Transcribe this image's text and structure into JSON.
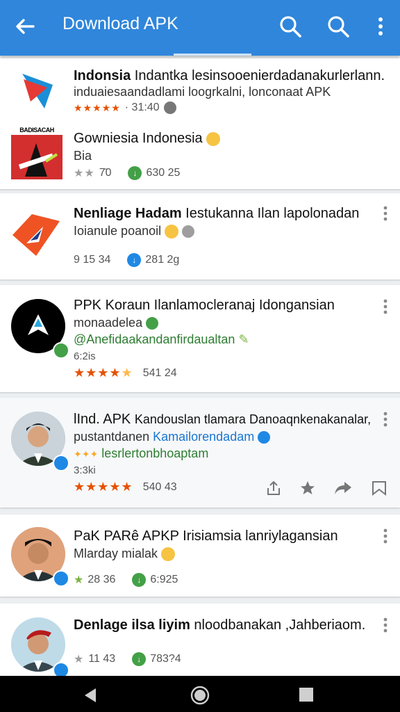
{
  "appbar": {
    "title": "Download APK"
  },
  "items": [
    {
      "title": "Indonsia",
      "title_rest": "Indantka lesinsooenierdadanakurlerlann.",
      "line2": "induaiesaandadlami loogrkalni, lonconaat APK",
      "stars": "★★★★★",
      "meta": "· 31:40"
    },
    {
      "title": "Gowniesia Indonesia",
      "line2": "Bia",
      "stars": "★★",
      "rating": "7̄0",
      "downloads": "630 25",
      "logo_text": "BADISACAH"
    },
    {
      "title": "Nenliage Hadam",
      "title_rest": "Iestukanna Ilan lapolonadan",
      "line2": "Ioianule poanoil",
      "rating": "9 15 34",
      "downloads": "281 2g"
    },
    {
      "title": "PPK Koraun",
      "title_rest": "Ilanlamocleranaj Idongansian",
      "line2": "monaadelea",
      "line3": "@Anefidaakandanfirdaualtan",
      "line4": "6:2is",
      "stars": "★★★★",
      "half": "★",
      "meta": "541 24"
    },
    {
      "title": "lInd. APK",
      "title_rest": "Kandouslan tlamara Danoaqnkenakanalar,",
      "line2": "pustantdanen",
      "line2_blue": "Kamailorendadam",
      "line3": "lesrlertonbhoaptam",
      "line4": "3:3ki",
      "stars": "★★★★★",
      "meta": "540 43"
    },
    {
      "title": "PaK PARê APKP",
      "title_rest": "Irisiamsia lanriylagansian",
      "line2": "Mlarday mialak",
      "rating": "28 36",
      "downloads": "6:925"
    },
    {
      "title": "Denlage ilsa liyim",
      "title_rest": "nloodbanakan ,Jahberiaom.",
      "rating": "11 43",
      "downloads": "783?4"
    }
  ]
}
